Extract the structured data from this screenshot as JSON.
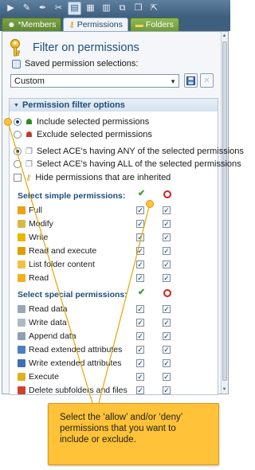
{
  "toolbar": {
    "buttons": [
      {
        "icon": "play-icon",
        "glyph": "▶"
      },
      {
        "icon": "pen-icon",
        "glyph": "✎"
      },
      {
        "icon": "brush-icon",
        "glyph": "✒"
      },
      {
        "icon": "tools-icon",
        "glyph": "✂"
      },
      {
        "icon": "window-icon",
        "glyph": "▤"
      },
      {
        "icon": "grid-icon",
        "glyph": "▦"
      },
      {
        "icon": "columns-icon",
        "glyph": "▥"
      },
      {
        "icon": "tree-icon",
        "glyph": "⧉"
      },
      {
        "icon": "pages-icon",
        "glyph": "❐"
      },
      {
        "icon": "export-icon",
        "glyph": "⇱"
      }
    ]
  },
  "tabs": [
    {
      "label": "*Members",
      "icon": "users-icon",
      "glyph": "☻"
    },
    {
      "label": "Permissions",
      "icon": "key-icon",
      "glyph": "⚷"
    },
    {
      "label": "Folders",
      "icon": "folder-icon",
      "glyph": "▬"
    }
  ],
  "panel": {
    "title": "Filter on permissions",
    "saved_label": "Saved permission selections:",
    "combo_value": "Custom",
    "filter_group_title": "Permission filter options",
    "include_label": "Include selected permissions",
    "exclude_label": "Exclude selected permissions",
    "any_label": "Select ACE's having ANY of the selected permissions",
    "all_label": "Select ACE's having ALL of the selected permissions",
    "hide_inherited_label": "Hide permissions that are inherited",
    "include_selected": true,
    "any_selected": true,
    "hide_inherited_checked": false,
    "simple_title": "Select simple permissions:",
    "special_title": "Select special permissions:",
    "simple_permissions": [
      {
        "label": "Full",
        "color": "#e8a317",
        "allow": true,
        "deny": true
      },
      {
        "label": "Modify",
        "color": "#d9b84a",
        "allow": true,
        "deny": true
      },
      {
        "label": "Write",
        "color": "#e6b800",
        "allow": true,
        "deny": true
      },
      {
        "label": "Read and execute",
        "color": "#e0a000",
        "allow": true,
        "deny": true
      },
      {
        "label": "List folder content",
        "color": "#f0c040",
        "allow": true,
        "deny": true
      },
      {
        "label": "Read",
        "color": "#f0b020",
        "allow": true,
        "deny": true
      }
    ],
    "special_permissions": [
      {
        "label": "Read data",
        "color": "#9aa6b4",
        "allow": true,
        "deny": true
      },
      {
        "label": "Write data",
        "color": "#b0bac6",
        "allow": true,
        "deny": true
      },
      {
        "label": "Append data",
        "color": "#8fa0b3",
        "allow": true,
        "deny": true
      },
      {
        "label": "Read extended attributes",
        "color": "#4a7fc0",
        "allow": true,
        "deny": true
      },
      {
        "label": "Write extended attributes",
        "color": "#3d6fae",
        "allow": true,
        "deny": true
      },
      {
        "label": "Execute",
        "color": "#e0b020",
        "allow": true,
        "deny": true
      },
      {
        "label": "Delete subfolders and files",
        "color": "#d04030",
        "allow": true,
        "deny": true
      }
    ]
  },
  "tooltip": {
    "text": "Select the ‘allow’ and/or ‘deny’ permissions that you want to include or exclude."
  }
}
